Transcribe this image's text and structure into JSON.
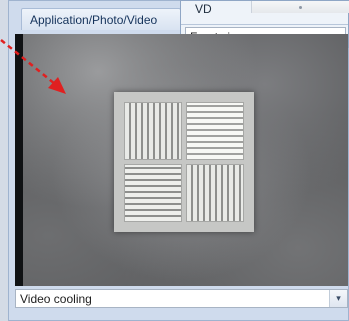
{
  "panel": {
    "tab_label": "Application/Photo/Video"
  },
  "view_popup": {
    "row_label": "VD",
    "selected_view": "Front view"
  },
  "video": {
    "content": "square ceiling diffuser with four slotted quadrants in smoke"
  },
  "video_select": {
    "selected": "Video cooling",
    "arrow_glyph": "▾"
  },
  "annotation": {
    "arrow_color": "#e02020"
  },
  "colors": {
    "panel_bg": "#cfdbed",
    "tab_text": "#15335b",
    "video_bg": "#5a5b5d"
  },
  "icons": {
    "dropdown": "chevron-down-icon",
    "pointer": "red-dashed-arrow-icon"
  }
}
